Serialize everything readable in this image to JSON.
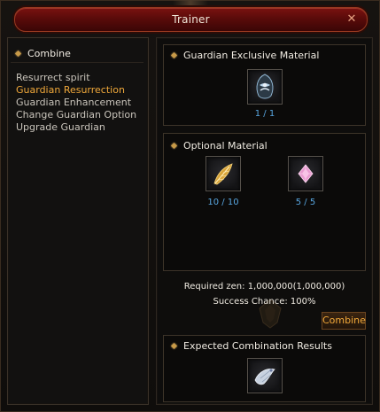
{
  "window": {
    "title": "Trainer",
    "close_label": "✕"
  },
  "left_panel": {
    "header": "Combine",
    "items": [
      {
        "label": "Resurrect spirit",
        "active": false
      },
      {
        "label": "Guardian Resurrection",
        "active": true
      },
      {
        "label": "Guardian Enhancement",
        "active": false
      },
      {
        "label": "Change Guardian Option",
        "active": false
      },
      {
        "label": "Upgrade Guardian",
        "active": false
      }
    ]
  },
  "exclusive": {
    "header": "Guardian Exclusive Material",
    "item_icon": "guardian-spirit-icon",
    "count": "1 / 1"
  },
  "optional": {
    "header": "Optional Material",
    "items": [
      {
        "icon": "golden-feather-icon",
        "count": "10 / 10"
      },
      {
        "icon": "pink-crystal-icon",
        "count": "5 / 5"
      }
    ]
  },
  "required_zen": "Required zen: 1,000,000(1,000,000)",
  "success_chance": "Success Chance: 100%",
  "combine_label": "Combine",
  "results": {
    "header": "Expected Combination Results",
    "item_icon": "guardian-pet-icon"
  },
  "colors": {
    "accent": "#f0a83a",
    "count": "#58a6e0",
    "title_bar": "#5a0b0a"
  }
}
